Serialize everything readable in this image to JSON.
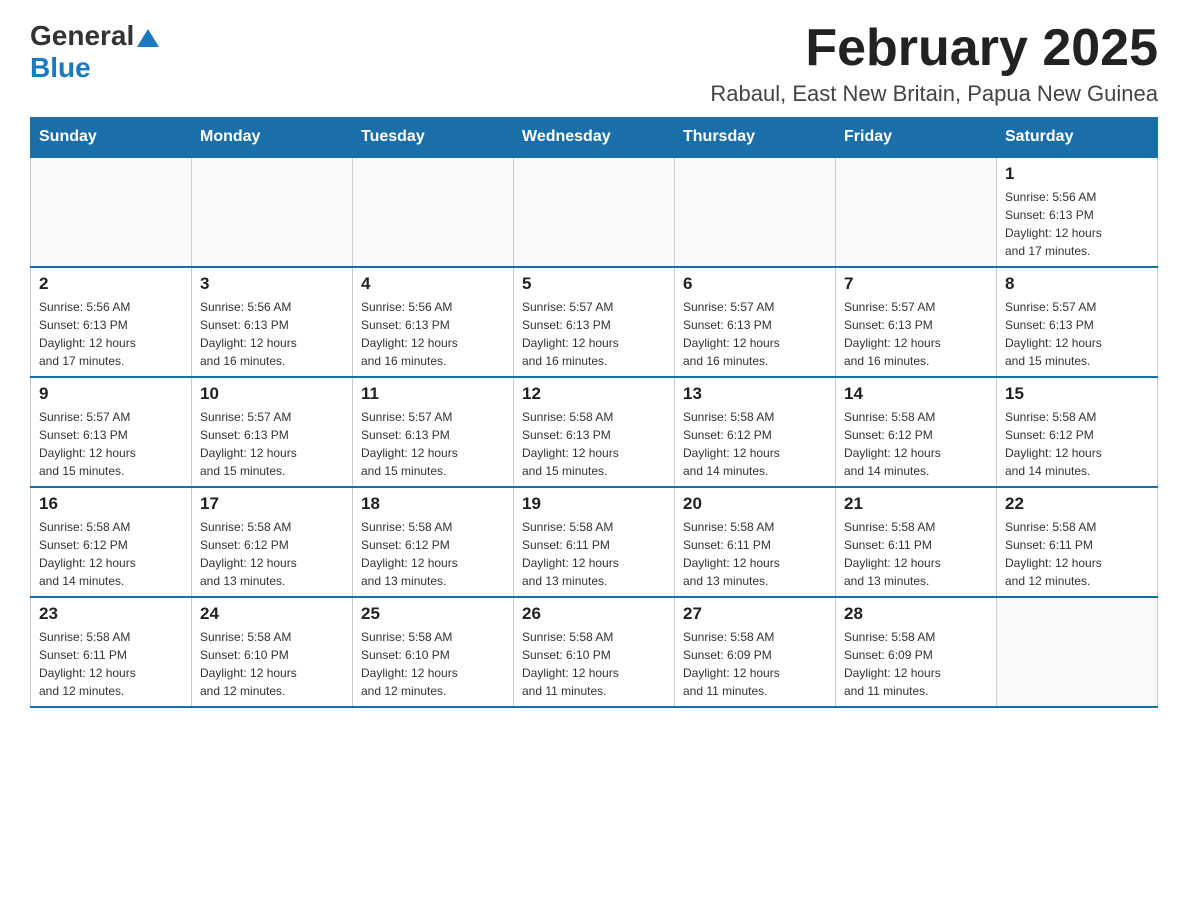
{
  "header": {
    "logo_general": "General",
    "logo_blue": "Blue",
    "month_title": "February 2025",
    "subtitle": "Rabaul, East New Britain, Papua New Guinea"
  },
  "weekdays": [
    "Sunday",
    "Monday",
    "Tuesday",
    "Wednesday",
    "Thursday",
    "Friday",
    "Saturday"
  ],
  "weeks": [
    [
      {
        "day": "",
        "info": ""
      },
      {
        "day": "",
        "info": ""
      },
      {
        "day": "",
        "info": ""
      },
      {
        "day": "",
        "info": ""
      },
      {
        "day": "",
        "info": ""
      },
      {
        "day": "",
        "info": ""
      },
      {
        "day": "1",
        "info": "Sunrise: 5:56 AM\nSunset: 6:13 PM\nDaylight: 12 hours\nand 17 minutes."
      }
    ],
    [
      {
        "day": "2",
        "info": "Sunrise: 5:56 AM\nSunset: 6:13 PM\nDaylight: 12 hours\nand 17 minutes."
      },
      {
        "day": "3",
        "info": "Sunrise: 5:56 AM\nSunset: 6:13 PM\nDaylight: 12 hours\nand 16 minutes."
      },
      {
        "day": "4",
        "info": "Sunrise: 5:56 AM\nSunset: 6:13 PM\nDaylight: 12 hours\nand 16 minutes."
      },
      {
        "day": "5",
        "info": "Sunrise: 5:57 AM\nSunset: 6:13 PM\nDaylight: 12 hours\nand 16 minutes."
      },
      {
        "day": "6",
        "info": "Sunrise: 5:57 AM\nSunset: 6:13 PM\nDaylight: 12 hours\nand 16 minutes."
      },
      {
        "day": "7",
        "info": "Sunrise: 5:57 AM\nSunset: 6:13 PM\nDaylight: 12 hours\nand 16 minutes."
      },
      {
        "day": "8",
        "info": "Sunrise: 5:57 AM\nSunset: 6:13 PM\nDaylight: 12 hours\nand 15 minutes."
      }
    ],
    [
      {
        "day": "9",
        "info": "Sunrise: 5:57 AM\nSunset: 6:13 PM\nDaylight: 12 hours\nand 15 minutes."
      },
      {
        "day": "10",
        "info": "Sunrise: 5:57 AM\nSunset: 6:13 PM\nDaylight: 12 hours\nand 15 minutes."
      },
      {
        "day": "11",
        "info": "Sunrise: 5:57 AM\nSunset: 6:13 PM\nDaylight: 12 hours\nand 15 minutes."
      },
      {
        "day": "12",
        "info": "Sunrise: 5:58 AM\nSunset: 6:13 PM\nDaylight: 12 hours\nand 15 minutes."
      },
      {
        "day": "13",
        "info": "Sunrise: 5:58 AM\nSunset: 6:12 PM\nDaylight: 12 hours\nand 14 minutes."
      },
      {
        "day": "14",
        "info": "Sunrise: 5:58 AM\nSunset: 6:12 PM\nDaylight: 12 hours\nand 14 minutes."
      },
      {
        "day": "15",
        "info": "Sunrise: 5:58 AM\nSunset: 6:12 PM\nDaylight: 12 hours\nand 14 minutes."
      }
    ],
    [
      {
        "day": "16",
        "info": "Sunrise: 5:58 AM\nSunset: 6:12 PM\nDaylight: 12 hours\nand 14 minutes."
      },
      {
        "day": "17",
        "info": "Sunrise: 5:58 AM\nSunset: 6:12 PM\nDaylight: 12 hours\nand 13 minutes."
      },
      {
        "day": "18",
        "info": "Sunrise: 5:58 AM\nSunset: 6:12 PM\nDaylight: 12 hours\nand 13 minutes."
      },
      {
        "day": "19",
        "info": "Sunrise: 5:58 AM\nSunset: 6:11 PM\nDaylight: 12 hours\nand 13 minutes."
      },
      {
        "day": "20",
        "info": "Sunrise: 5:58 AM\nSunset: 6:11 PM\nDaylight: 12 hours\nand 13 minutes."
      },
      {
        "day": "21",
        "info": "Sunrise: 5:58 AM\nSunset: 6:11 PM\nDaylight: 12 hours\nand 13 minutes."
      },
      {
        "day": "22",
        "info": "Sunrise: 5:58 AM\nSunset: 6:11 PM\nDaylight: 12 hours\nand 12 minutes."
      }
    ],
    [
      {
        "day": "23",
        "info": "Sunrise: 5:58 AM\nSunset: 6:11 PM\nDaylight: 12 hours\nand 12 minutes."
      },
      {
        "day": "24",
        "info": "Sunrise: 5:58 AM\nSunset: 6:10 PM\nDaylight: 12 hours\nand 12 minutes."
      },
      {
        "day": "25",
        "info": "Sunrise: 5:58 AM\nSunset: 6:10 PM\nDaylight: 12 hours\nand 12 minutes."
      },
      {
        "day": "26",
        "info": "Sunrise: 5:58 AM\nSunset: 6:10 PM\nDaylight: 12 hours\nand 11 minutes."
      },
      {
        "day": "27",
        "info": "Sunrise: 5:58 AM\nSunset: 6:09 PM\nDaylight: 12 hours\nand 11 minutes."
      },
      {
        "day": "28",
        "info": "Sunrise: 5:58 AM\nSunset: 6:09 PM\nDaylight: 12 hours\nand 11 minutes."
      },
      {
        "day": "",
        "info": ""
      }
    ]
  ]
}
